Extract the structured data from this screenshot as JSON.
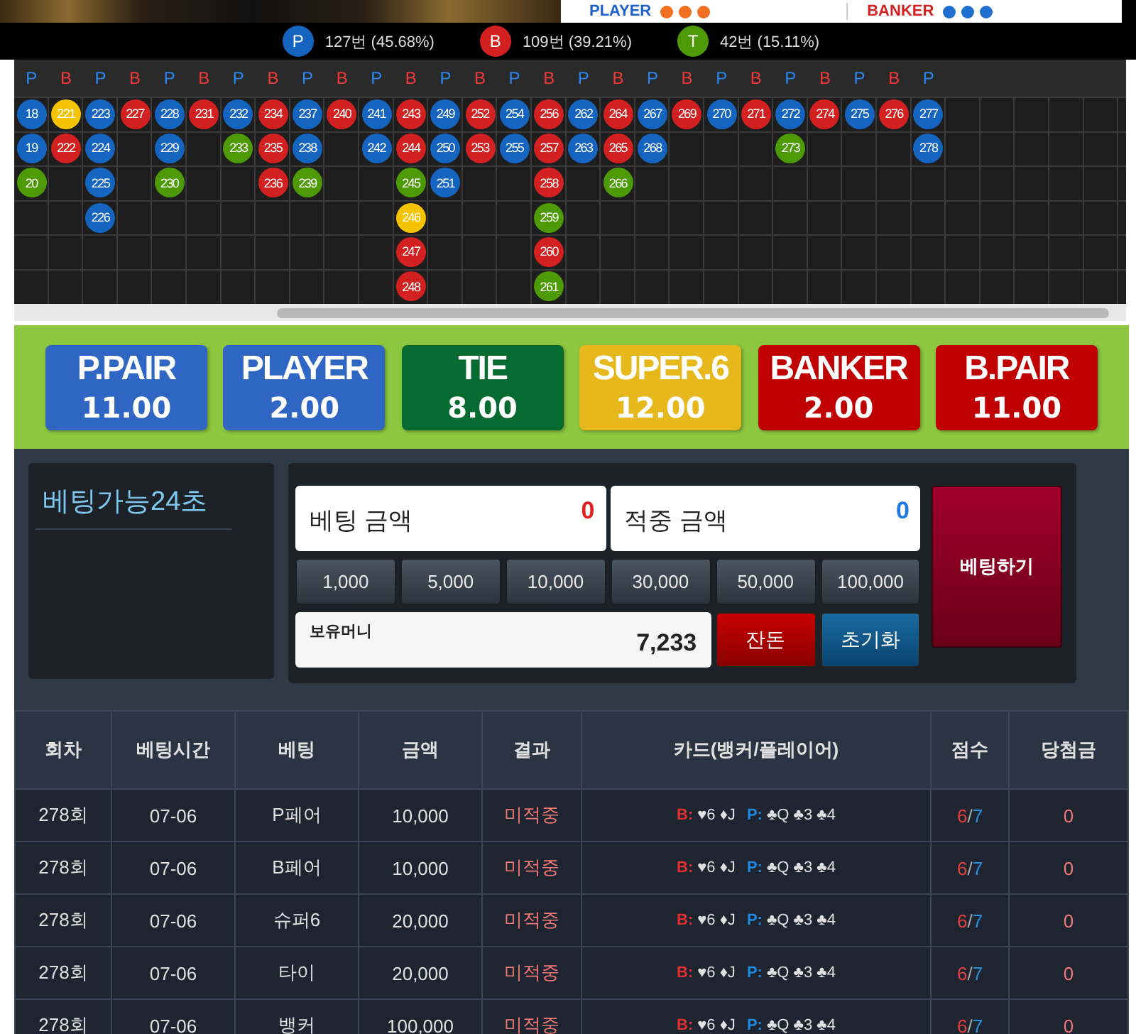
{
  "top_strip": {
    "player_label": "PLAYER",
    "banker_label": "BANKER"
  },
  "stats": [
    {
      "letter": "P",
      "color": "#1565c0",
      "text": "127번 (45.68%)"
    },
    {
      "letter": "B",
      "color": "#d32020",
      "text": "109번 (39.21%)"
    },
    {
      "letter": "T",
      "color": "#4e9a06",
      "text": "42번 (15.11%)"
    }
  ],
  "bead_road": {
    "columns": [
      {
        "header": "P",
        "kind": "player",
        "beads": [
          {
            "n": "18",
            "color": "#1565c0"
          },
          {
            "n": "19",
            "color": "#1565c0"
          },
          {
            "n": "20",
            "color": "#4e9a06"
          }
        ]
      },
      {
        "header": "B",
        "kind": "banker",
        "beads": [
          {
            "n": "221",
            "color": "#f5c400"
          },
          {
            "n": "222",
            "color": "#d32020"
          }
        ]
      },
      {
        "header": "P",
        "kind": "player",
        "beads": [
          {
            "n": "223",
            "color": "#1565c0"
          },
          {
            "n": "224",
            "color": "#1565c0"
          },
          {
            "n": "225",
            "color": "#1565c0"
          },
          {
            "n": "226",
            "color": "#1565c0"
          }
        ]
      },
      {
        "header": "B",
        "kind": "banker",
        "beads": [
          {
            "n": "227",
            "color": "#d32020"
          }
        ]
      },
      {
        "header": "P",
        "kind": "player",
        "beads": [
          {
            "n": "228",
            "color": "#1565c0"
          },
          {
            "n": "229",
            "color": "#1565c0"
          },
          {
            "n": "230",
            "color": "#4e9a06"
          }
        ]
      },
      {
        "header": "B",
        "kind": "banker",
        "beads": [
          {
            "n": "231",
            "color": "#d32020"
          }
        ]
      },
      {
        "header": "P",
        "kind": "player",
        "beads": [
          {
            "n": "232",
            "color": "#1565c0"
          },
          {
            "n": "233",
            "color": "#4e9a06"
          }
        ]
      },
      {
        "header": "B",
        "kind": "banker",
        "beads": [
          {
            "n": "234",
            "color": "#d32020"
          },
          {
            "n": "235",
            "color": "#d32020"
          },
          {
            "n": "236",
            "color": "#d32020"
          }
        ]
      },
      {
        "header": "P",
        "kind": "player",
        "beads": [
          {
            "n": "237",
            "color": "#1565c0"
          },
          {
            "n": "238",
            "color": "#1565c0"
          },
          {
            "n": "239",
            "color": "#4e9a06"
          }
        ]
      },
      {
        "header": "B",
        "kind": "banker",
        "beads": [
          {
            "n": "240",
            "color": "#d32020"
          }
        ]
      },
      {
        "header": "P",
        "kind": "player",
        "beads": [
          {
            "n": "241",
            "color": "#1565c0"
          },
          {
            "n": "242",
            "color": "#1565c0"
          }
        ]
      },
      {
        "header": "B",
        "kind": "banker",
        "beads": [
          {
            "n": "243",
            "color": "#d32020"
          },
          {
            "n": "244",
            "color": "#d32020"
          },
          {
            "n": "245",
            "color": "#4e9a06"
          },
          {
            "n": "246",
            "color": "#f5c400"
          },
          {
            "n": "247",
            "color": "#d32020"
          },
          {
            "n": "248",
            "color": "#d32020"
          }
        ]
      },
      {
        "header": "P",
        "kind": "player",
        "beads": [
          {
            "n": "249",
            "color": "#1565c0"
          },
          {
            "n": "250",
            "color": "#1565c0"
          },
          {
            "n": "251",
            "color": "#1565c0"
          }
        ]
      },
      {
        "header": "B",
        "kind": "banker",
        "beads": [
          {
            "n": "252",
            "color": "#d32020"
          },
          {
            "n": "253",
            "color": "#d32020"
          }
        ]
      },
      {
        "header": "P",
        "kind": "player",
        "beads": [
          {
            "n": "254",
            "color": "#1565c0"
          },
          {
            "n": "255",
            "color": "#1565c0"
          }
        ]
      },
      {
        "header": "B",
        "kind": "banker",
        "beads": [
          {
            "n": "256",
            "color": "#d32020"
          },
          {
            "n": "257",
            "color": "#d32020"
          },
          {
            "n": "258",
            "color": "#d32020"
          },
          {
            "n": "259",
            "color": "#4e9a06"
          },
          {
            "n": "260",
            "color": "#d32020"
          },
          {
            "n": "261",
            "color": "#4e9a06"
          }
        ]
      },
      {
        "header": "P",
        "kind": "player",
        "beads": [
          {
            "n": "262",
            "color": "#1565c0"
          },
          {
            "n": "263",
            "color": "#1565c0"
          }
        ]
      },
      {
        "header": "B",
        "kind": "banker",
        "beads": [
          {
            "n": "264",
            "color": "#d32020"
          },
          {
            "n": "265",
            "color": "#d32020"
          },
          {
            "n": "266",
            "color": "#4e9a06"
          }
        ]
      },
      {
        "header": "P",
        "kind": "player",
        "beads": [
          {
            "n": "267",
            "color": "#1565c0"
          },
          {
            "n": "268",
            "color": "#1565c0"
          }
        ]
      },
      {
        "header": "B",
        "kind": "banker",
        "beads": [
          {
            "n": "269",
            "color": "#d32020"
          }
        ]
      },
      {
        "header": "P",
        "kind": "player",
        "beads": [
          {
            "n": "270",
            "color": "#1565c0"
          }
        ]
      },
      {
        "header": "B",
        "kind": "banker",
        "beads": [
          {
            "n": "271",
            "color": "#d32020"
          }
        ]
      },
      {
        "header": "P",
        "kind": "player",
        "beads": [
          {
            "n": "272",
            "color": "#1565c0"
          },
          {
            "n": "273",
            "color": "#4e9a06"
          }
        ]
      },
      {
        "header": "B",
        "kind": "banker",
        "beads": [
          {
            "n": "274",
            "color": "#d32020"
          }
        ]
      },
      {
        "header": "P",
        "kind": "player",
        "beads": [
          {
            "n": "275",
            "color": "#1565c0"
          }
        ]
      },
      {
        "header": "B",
        "kind": "banker",
        "beads": [
          {
            "n": "276",
            "color": "#d32020"
          }
        ]
      },
      {
        "header": "P",
        "kind": "player",
        "beads": [
          {
            "n": "277",
            "color": "#1565c0"
          },
          {
            "n": "278",
            "color": "#1565c0"
          }
        ]
      }
    ]
  },
  "bet_options": [
    {
      "label": "P.PAIR",
      "odds": "11.00",
      "color": "#2f66c4"
    },
    {
      "label": "PLAYER",
      "odds": "2.00",
      "color": "#2f66c4"
    },
    {
      "label": "TIE",
      "odds": "8.00",
      "color": "#066b30"
    },
    {
      "label": "SUPER.6",
      "odds": "12.00",
      "color": "#e6b81c"
    },
    {
      "label": "BANKER",
      "odds": "2.00",
      "color": "#c00000"
    },
    {
      "label": "B.PAIR",
      "odds": "11.00",
      "color": "#c00000"
    }
  ],
  "timer": "베팅가능24초",
  "bet_amount": {
    "label": "베팅 금액",
    "value": "0"
  },
  "hit_amount": {
    "label": "적중 금액",
    "value": "0"
  },
  "chips": [
    "1,000",
    "5,000",
    "10,000",
    "30,000",
    "50,000",
    "100,000"
  ],
  "balance": {
    "label": "보유머니",
    "value": "7,233"
  },
  "change_button": "잔돈",
  "reset_button": "초기화",
  "bet_button": "베팅하기",
  "history": {
    "columns": [
      "회차",
      "베팅시간",
      "베팅",
      "금액",
      "결과",
      "카드(뱅커/플레이어)",
      "점수",
      "당첨금"
    ],
    "rows": [
      {
        "round": "278회",
        "time": "07-06",
        "bet": "P페어",
        "amount": "10,000",
        "result": "미적중",
        "b_label": "B:",
        "b_cards": "♥6 ♦J",
        "p_label": "P:",
        "p_cards": "♣Q ♣3 ♣4",
        "b_score": "6",
        "score_separator": "/",
        "p_score": "7",
        "win": "0"
      },
      {
        "round": "278회",
        "time": "07-06",
        "bet": "B페어",
        "amount": "10,000",
        "result": "미적중",
        "b_label": "B:",
        "b_cards": "♥6 ♦J",
        "p_label": "P:",
        "p_cards": "♣Q ♣3 ♣4",
        "b_score": "6",
        "score_separator": "/",
        "p_score": "7",
        "win": "0"
      },
      {
        "round": "278회",
        "time": "07-06",
        "bet": "슈퍼6",
        "amount": "20,000",
        "result": "미적중",
        "b_label": "B:",
        "b_cards": "♥6 ♦J",
        "p_label": "P:",
        "p_cards": "♣Q ♣3 ♣4",
        "b_score": "6",
        "score_separator": "/",
        "p_score": "7",
        "win": "0"
      },
      {
        "round": "278회",
        "time": "07-06",
        "bet": "타이",
        "amount": "20,000",
        "result": "미적중",
        "b_label": "B:",
        "b_cards": "♥6 ♦J",
        "p_label": "P:",
        "p_cards": "♣Q ♣3 ♣4",
        "b_score": "6",
        "score_separator": "/",
        "p_score": "7",
        "win": "0"
      },
      {
        "round": "278회",
        "time": "07-06",
        "bet": "뱅커",
        "amount": "100,000",
        "result": "미적중",
        "b_label": "B:",
        "b_cards": "♥6 ♦J",
        "p_label": "P:",
        "p_cards": "♣Q ♣3 ♣4",
        "b_score": "6",
        "score_separator": "/",
        "p_score": "7",
        "win": "0"
      }
    ]
  }
}
